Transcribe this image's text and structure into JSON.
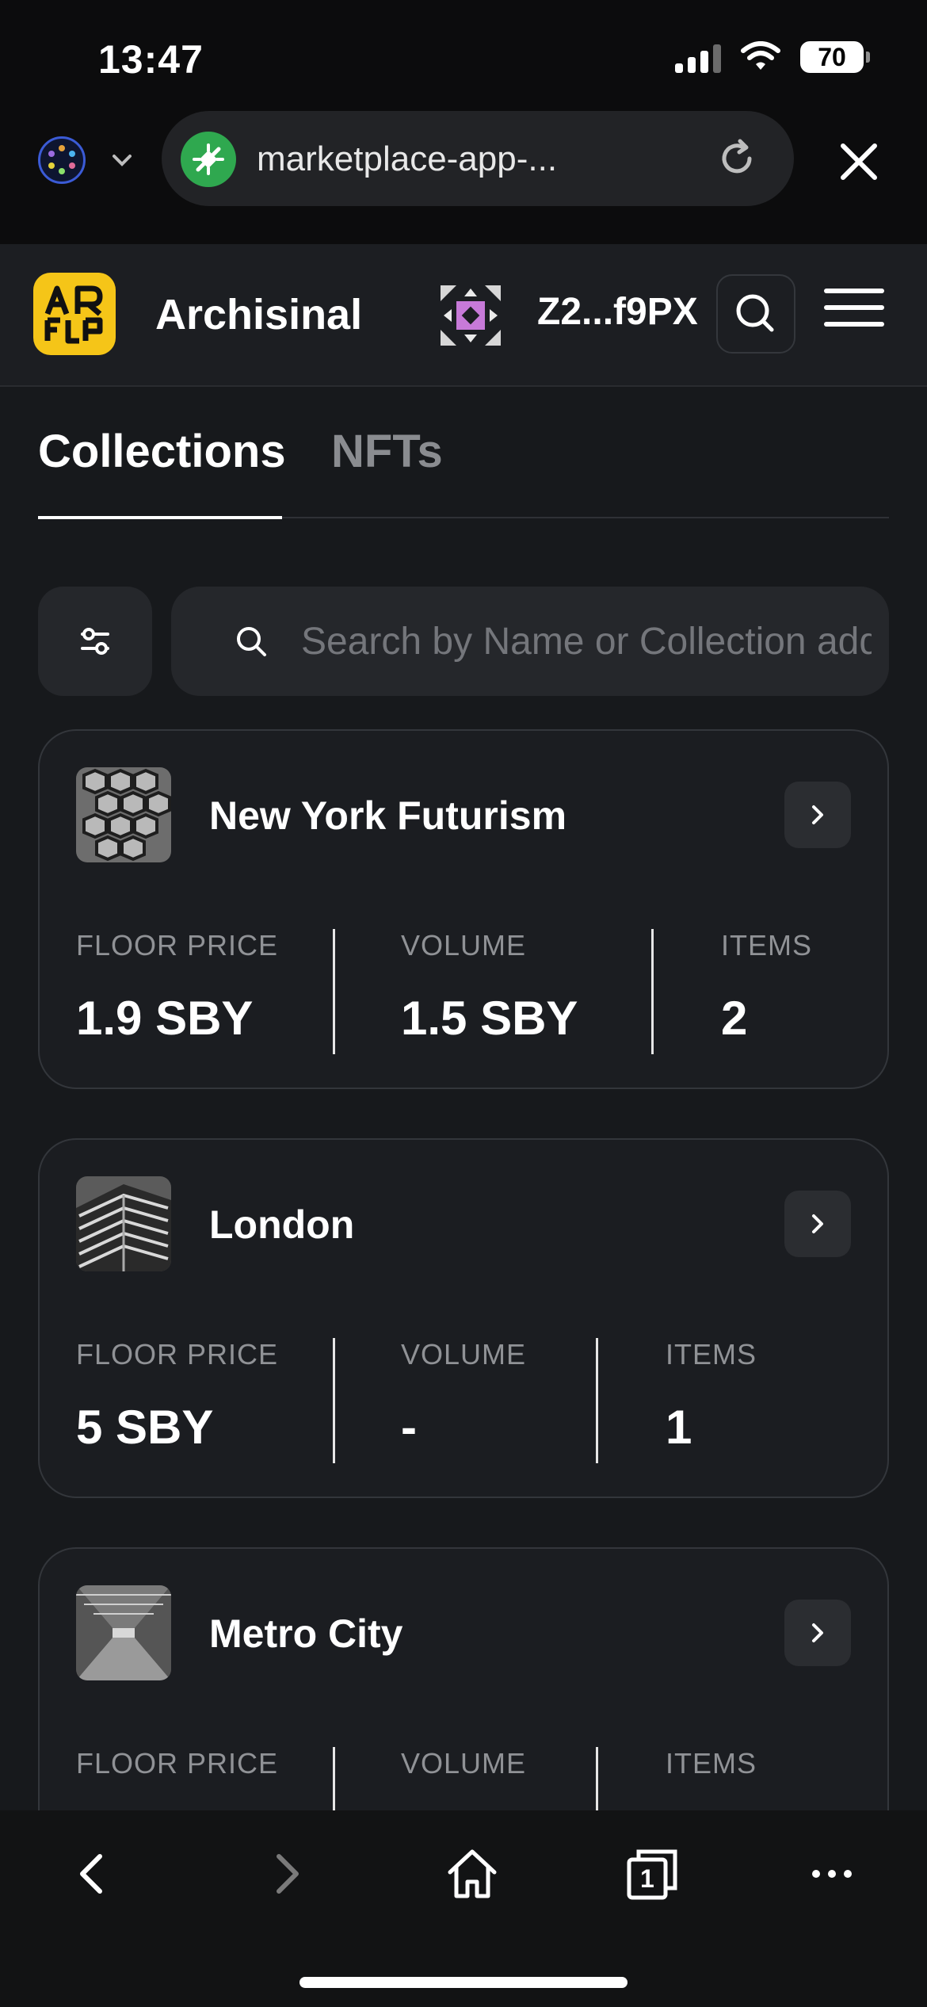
{
  "status_bar": {
    "time": "13:47",
    "battery": "70",
    "icons": [
      "cellular-signal-icon",
      "wifi-icon",
      "battery-icon"
    ]
  },
  "browser": {
    "url": "marketplace-app-...",
    "icons": [
      "network-switch-icon",
      "chevron-down-icon",
      "site-security-icon",
      "reload-icon",
      "close-icon"
    ]
  },
  "header": {
    "brand": "Archisinal",
    "logo_text": "AR",
    "wallet_address": "Z2...f9PX",
    "icons": [
      "wallet-avatar-icon",
      "search-icon",
      "hamburger-menu-icon"
    ]
  },
  "tabs": [
    {
      "label": "Collections",
      "active": true
    },
    {
      "label": "NFTs",
      "active": false
    }
  ],
  "search": {
    "placeholder": "Search by Name or Collection address",
    "value": ""
  },
  "collections": [
    {
      "name": "New York Futurism",
      "floor_label": "FLOOR PRICE",
      "floor": "1.9 SBY",
      "volume_label": "VOLUME",
      "volume": "1.5 SBY",
      "items_label": "ITEMS",
      "items": "2"
    },
    {
      "name": "London",
      "floor_label": "FLOOR PRICE",
      "floor": "5 SBY",
      "volume_label": "VOLUME",
      "volume": "-",
      "items_label": "ITEMS",
      "items": "1"
    },
    {
      "name": "Metro City",
      "floor_label": "FLOOR PRICE",
      "floor": "",
      "volume_label": "VOLUME",
      "volume": "",
      "items_label": "ITEMS",
      "items": ""
    }
  ],
  "toolbar": {
    "tab_count": "1",
    "icons": [
      "back-icon",
      "forward-icon",
      "home-icon",
      "tabs-icon",
      "more-icon"
    ]
  },
  "colors": {
    "background": "#17191c",
    "card": "#1b1d21",
    "accent_logo": "#f5c518",
    "muted_text": "#909296"
  }
}
